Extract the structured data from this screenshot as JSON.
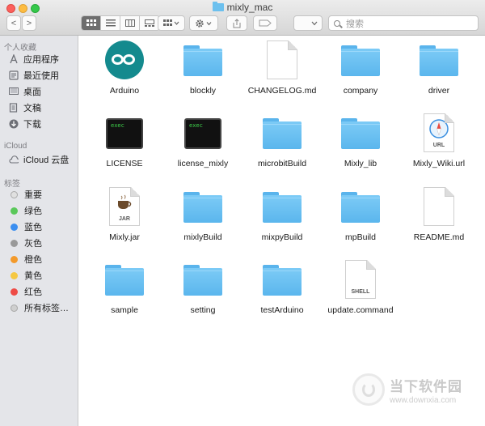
{
  "window": {
    "title": "mixly_mac"
  },
  "toolbar": {
    "back_label": "<",
    "forward_label": ">",
    "search_placeholder": "搜索"
  },
  "sidebar": {
    "favorites_header": "个人收藏",
    "favorites": [
      {
        "label": "应用程序",
        "icon": "applications-icon"
      },
      {
        "label": "最近使用",
        "icon": "recents-icon"
      },
      {
        "label": "桌面",
        "icon": "desktop-icon"
      },
      {
        "label": "文稿",
        "icon": "documents-icon"
      },
      {
        "label": "下载",
        "icon": "downloads-icon"
      }
    ],
    "icloud_header": "iCloud",
    "icloud": [
      {
        "label": "iCloud 云盘",
        "icon": "cloud-icon"
      }
    ],
    "tags_header": "标签",
    "tags": [
      {
        "label": "重要",
        "color": "#e0e0e0"
      },
      {
        "label": "绿色",
        "color": "#5ac85a"
      },
      {
        "label": "蓝色",
        "color": "#3b8ef0"
      },
      {
        "label": "灰色",
        "color": "#999999"
      },
      {
        "label": "橙色",
        "color": "#f39a2b"
      },
      {
        "label": "黄色",
        "color": "#f5c842"
      },
      {
        "label": "红色",
        "color": "#ee4b46"
      },
      {
        "label": "所有标签…",
        "color": "#cfcfcf"
      }
    ]
  },
  "files": [
    {
      "name": "Arduino",
      "kind": "arduino-app-icon"
    },
    {
      "name": "blockly",
      "kind": "folder-icon"
    },
    {
      "name": "CHANGELOG.md",
      "kind": "document-icon"
    },
    {
      "name": "company",
      "kind": "folder-icon"
    },
    {
      "name": "driver",
      "kind": "folder-icon"
    },
    {
      "name": "LICENSE",
      "kind": "terminal-exec-icon",
      "badge": "exec"
    },
    {
      "name": "license_mixly",
      "kind": "terminal-exec-icon",
      "badge": "exec"
    },
    {
      "name": "microbitBuild",
      "kind": "folder-icon"
    },
    {
      "name": "Mixly_lib",
      "kind": "folder-icon"
    },
    {
      "name": "Mixly_Wiki.url",
      "kind": "url-document-icon",
      "badge": "URL"
    },
    {
      "name": "Mixly.jar",
      "kind": "jar-document-icon",
      "badge": "JAR"
    },
    {
      "name": "mixlyBuild",
      "kind": "folder-icon"
    },
    {
      "name": "mixpyBuild",
      "kind": "folder-icon"
    },
    {
      "name": "mpBuild",
      "kind": "folder-icon"
    },
    {
      "name": "README.md",
      "kind": "document-icon"
    },
    {
      "name": "sample",
      "kind": "folder-icon"
    },
    {
      "name": "setting",
      "kind": "folder-icon"
    },
    {
      "name": "testArduino",
      "kind": "folder-icon"
    },
    {
      "name": "update.command",
      "kind": "shell-document-icon",
      "badge": "SHELL"
    }
  ],
  "watermark": {
    "title": "当下软件园",
    "url": "www.downxia.com"
  }
}
